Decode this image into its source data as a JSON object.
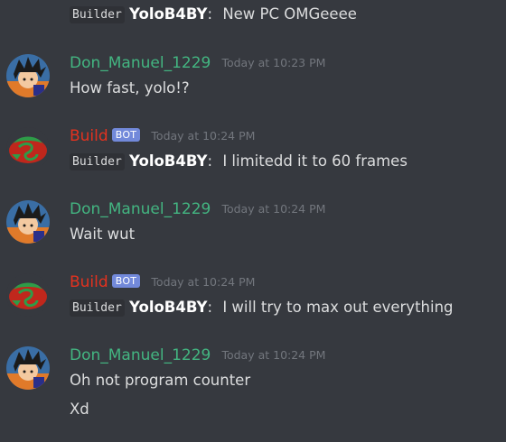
{
  "messages": {
    "m0": {
      "line1": {
        "code": "Builder",
        "name": "YoloB4BY",
        "sep": ":",
        "text": "New PC OMGeeee"
      }
    },
    "m1": {
      "author": "Don_Manuel_1229",
      "timestamp": "Today at 10:23 PM",
      "line1": {
        "text": "How fast, yolo!?"
      }
    },
    "m2": {
      "author": "Build",
      "bot_tag": "BOT",
      "timestamp": "Today at 10:24 PM",
      "line1": {
        "code": "Builder",
        "name": "YoloB4BY",
        "sep": ":",
        "text": "I limitedd it to 60 frames"
      }
    },
    "m3": {
      "author": "Don_Manuel_1229",
      "timestamp": "Today at 10:24 PM",
      "line1": {
        "text": "Wait wut"
      }
    },
    "m4": {
      "author": "Build",
      "bot_tag": "BOT",
      "timestamp": "Today at 10:24 PM",
      "line1": {
        "code": "Builder",
        "name": "YoloB4BY",
        "sep": ":",
        "text": "I will try to max out everything"
      }
    },
    "m5": {
      "author": "Don_Manuel_1229",
      "timestamp": "Today at 10:24 PM",
      "line1": {
        "text": "Oh not program counter"
      },
      "line2": {
        "text": "Xd"
      }
    }
  },
  "colors": {
    "background": "#36393f",
    "human_author": "#43b581",
    "bot_author": "#e3321f",
    "bot_tag": "#7289da",
    "timestamp": "#72767d",
    "message_text": "#dcddde",
    "code_background": "#2f3136"
  },
  "icons": {
    "human_avatar": "goku-avatar-icon",
    "bot_avatar": "dragon-logo-avatar-icon"
  }
}
